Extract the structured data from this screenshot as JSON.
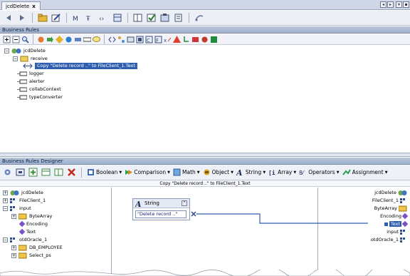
{
  "editor_tab": {
    "title": "jcdDelete",
    "close_label": "x"
  },
  "tab_nav": {
    "left": "◂",
    "right": "▸",
    "menu": "▾",
    "close": "▪"
  },
  "panels": {
    "business_rules": "Business Rules",
    "designer": "Business Rules Designer"
  },
  "tree": {
    "root": "jcdDelete",
    "receive": "receive",
    "selected_rule": "Copy \"Delete record ..\" to FileClient_1.Text",
    "items": [
      "logger",
      "alerter",
      "collabContext",
      "typeConverter"
    ]
  },
  "designer_toolbar": {
    "boolean": "Boolean",
    "comparison": "Comparison",
    "math": "Math",
    "object": "Object",
    "string": "String",
    "array": "Array",
    "operators": "Operators",
    "assignment": "Assignment"
  },
  "rule_caption": "Copy \"Delete record ..\" to FileClient_1.Text",
  "left_tree": {
    "root": "jcdDelete",
    "file_client": "FileClient_1",
    "input": "input",
    "byte_array": "ByteArray",
    "encoding": "Encoding",
    "text": "Text",
    "otd_oracle": "otdOracle_1",
    "db_employee": "DB_EMPLOYEE",
    "select_ps": "Select_ps"
  },
  "string_box": {
    "title": "String",
    "value": "\"Delete record ..\"",
    "collapse": "^"
  },
  "right_tree": {
    "root": "jcdDelete",
    "file_client": "FileClient_1",
    "byte_array": "ByteArray",
    "encoding": "Encoding",
    "text": "Text",
    "input": "input",
    "otd_oracle": "otdOracle_1"
  },
  "colors": {
    "selection": "#315fb0",
    "panel_header": "#b9c6dc",
    "mapping_line": "#315fb0"
  }
}
